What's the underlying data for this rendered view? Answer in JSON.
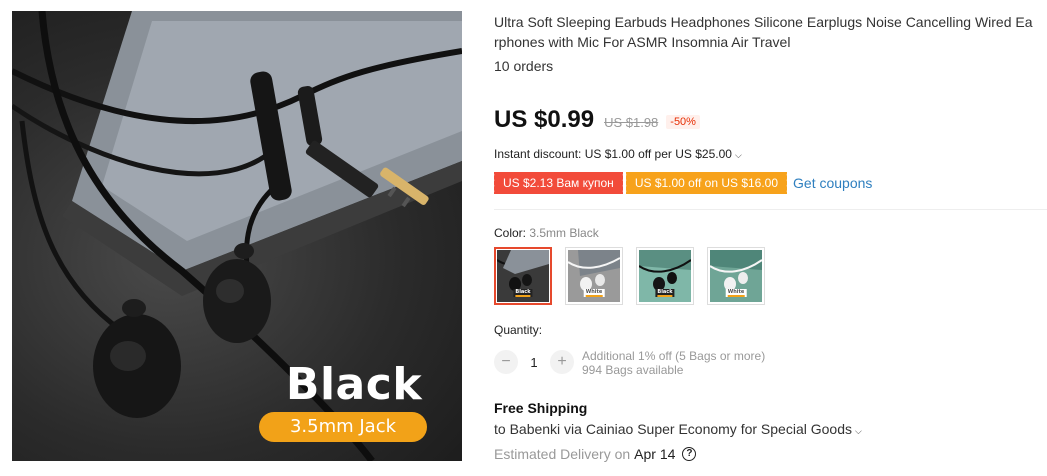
{
  "product": {
    "title_line1": "Ultra Soft Sleeping Earbuds Headphones Silicone Earplugs Noise Cancelling Wired Ea",
    "title_line2": "rphones with Mic For ASMR Insomnia Air Travel",
    "orders": "10 orders"
  },
  "hero": {
    "label": "Black",
    "pill": "3.5mm Jack",
    "colors": {
      "pill": "#f2a218",
      "background": "#2b2b2b"
    }
  },
  "price": {
    "current": "US $0.99",
    "original": "US $1.98",
    "discount": "-50%"
  },
  "instant_discount": "Instant discount: US $1.00 off per US $25.00",
  "coupons": {
    "store_coupon": "US $2.13 Вам купон",
    "off_coupon": "US $1.00 off on US $16.00",
    "get_coupons": "Get coupons"
  },
  "color": {
    "label": "Color:",
    "selected": "3.5mm Black",
    "options": [
      {
        "tag": "Black",
        "theme": "dark"
      },
      {
        "tag": "White",
        "theme": "light"
      },
      {
        "tag": "Black",
        "theme": "mint-dark"
      },
      {
        "tag": "White",
        "theme": "mint-light"
      }
    ]
  },
  "quantity": {
    "label": "Quantity:",
    "value": "1",
    "minus": "−",
    "plus": "+",
    "note_line1": "Additional 1% off (5 Bags or more)",
    "note_line2": "994 Bags available"
  },
  "shipping": {
    "title": "Free Shipping",
    "to": "to Babenki via Cainiao Super Economy for Special Goods",
    "delivery_label": "Estimated Delivery on",
    "delivery_date": "Apr 14"
  },
  "icons": {
    "chevron": "chevron-down-icon",
    "help": "help-circle-icon"
  },
  "colors": {
    "accent_red": "#e62e04",
    "coupon_red": "#f24b3a",
    "coupon_orange": "#f7a21b",
    "link_blue": "#2e7fbf"
  }
}
